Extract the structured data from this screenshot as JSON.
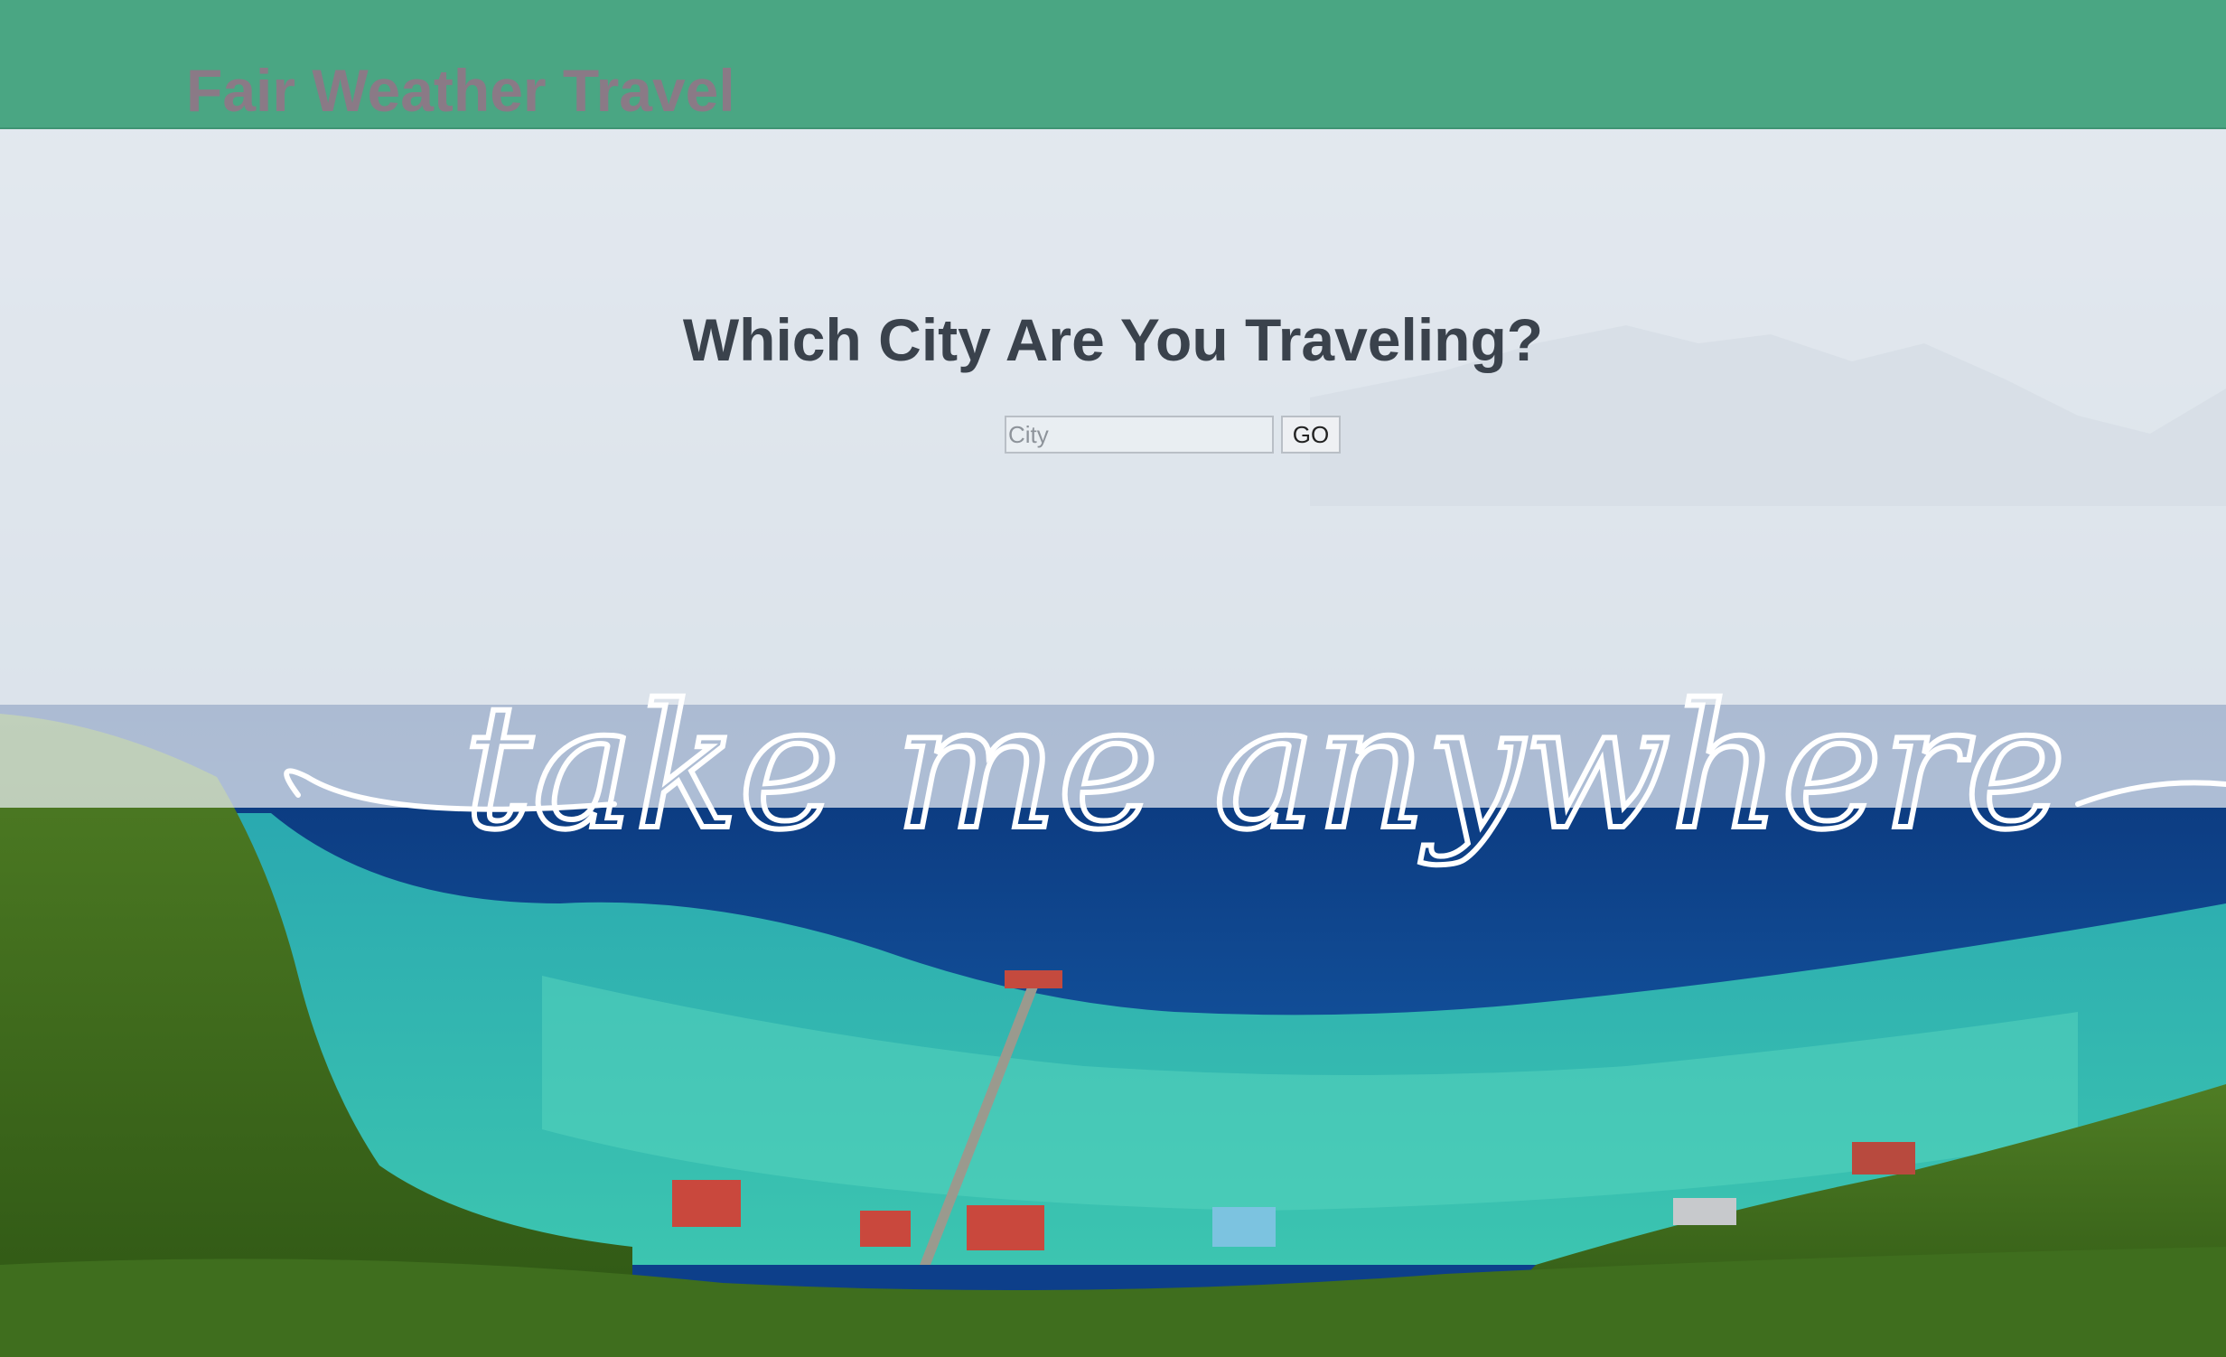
{
  "navbar": {
    "brand": "Fair Weather Travel"
  },
  "main": {
    "heading": "Which City Are You Traveling?",
    "search": {
      "placeholder": "City",
      "value": "",
      "button_label": "GO"
    }
  },
  "hero": {
    "tagline": "take me anywhere"
  },
  "colors": {
    "navbar_bg": "#4aa683",
    "brand_text": "#8a7a86",
    "heading_text": "#3a424c",
    "deep_water": "#0d3f8a",
    "lagoon": "#2bb3a8",
    "forest": "#3f6e1e"
  }
}
